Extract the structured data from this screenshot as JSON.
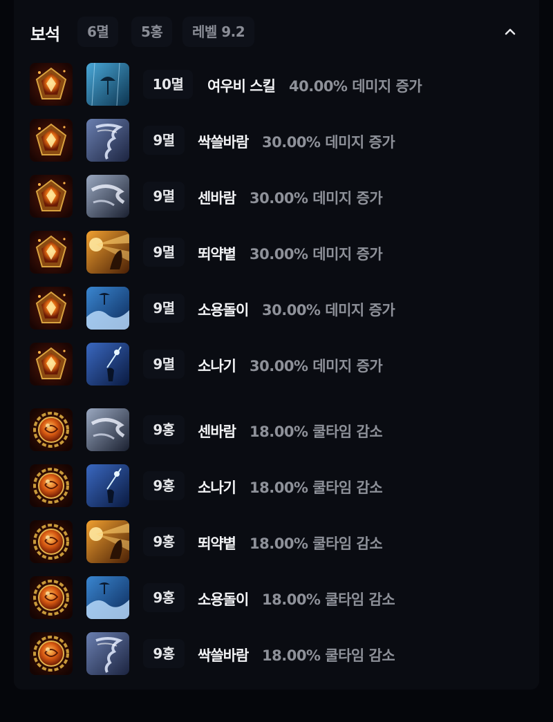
{
  "header": {
    "title": "보석",
    "chips": [
      "6멸",
      "5홍",
      "레벨 9.2"
    ]
  },
  "gems": [
    {
      "type": "damage",
      "skill_art": "umbrella-rain",
      "level": "10멸",
      "skill": "여우비 스킬",
      "effect": "40.00% 데미지 증가"
    },
    {
      "type": "damage",
      "skill_art": "tornado",
      "level": "9멸",
      "skill": "싹쓸바람",
      "effect": "30.00% 데미지 증가"
    },
    {
      "type": "damage",
      "skill_art": "gust",
      "level": "9멸",
      "skill": "센바람",
      "effect": "30.00% 데미지 증가"
    },
    {
      "type": "damage",
      "skill_art": "sunburst",
      "level": "9멸",
      "skill": "뙤약볕",
      "effect": "30.00% 데미지 증가"
    },
    {
      "type": "damage",
      "skill_art": "wave",
      "level": "9멸",
      "skill": "소용돌이",
      "effect": "30.00% 데미지 증가"
    },
    {
      "type": "damage",
      "skill_art": "shower",
      "level": "9멸",
      "skill": "소나기",
      "effect": "30.00% 데미지 증가"
    },
    {
      "type": "cooldown",
      "skill_art": "gust",
      "level": "9홍",
      "skill": "센바람",
      "effect": "18.00% 쿨타임 감소"
    },
    {
      "type": "cooldown",
      "skill_art": "shower",
      "level": "9홍",
      "skill": "소나기",
      "effect": "18.00% 쿨타임 감소"
    },
    {
      "type": "cooldown",
      "skill_art": "sunburst",
      "level": "9홍",
      "skill": "뙤약볕",
      "effect": "18.00% 쿨타임 감소"
    },
    {
      "type": "cooldown",
      "skill_art": "wave",
      "level": "9홍",
      "skill": "소용돌이",
      "effect": "18.00% 쿨타임 감소"
    },
    {
      "type": "cooldown",
      "skill_art": "tornado",
      "level": "9홍",
      "skill": "싹쓸바람",
      "effect": "18.00% 쿨타임 감소"
    }
  ],
  "icons": {
    "collapse": "chevron-up-icon",
    "damage_gem": "damage-gem-icon",
    "cooldown_gem": "cooldown-gem-icon"
  },
  "colors": {
    "background": "#05060b",
    "panel": "#0a0c12",
    "text_primary": "#f3f4f6",
    "text_secondary": "#8e9199"
  }
}
